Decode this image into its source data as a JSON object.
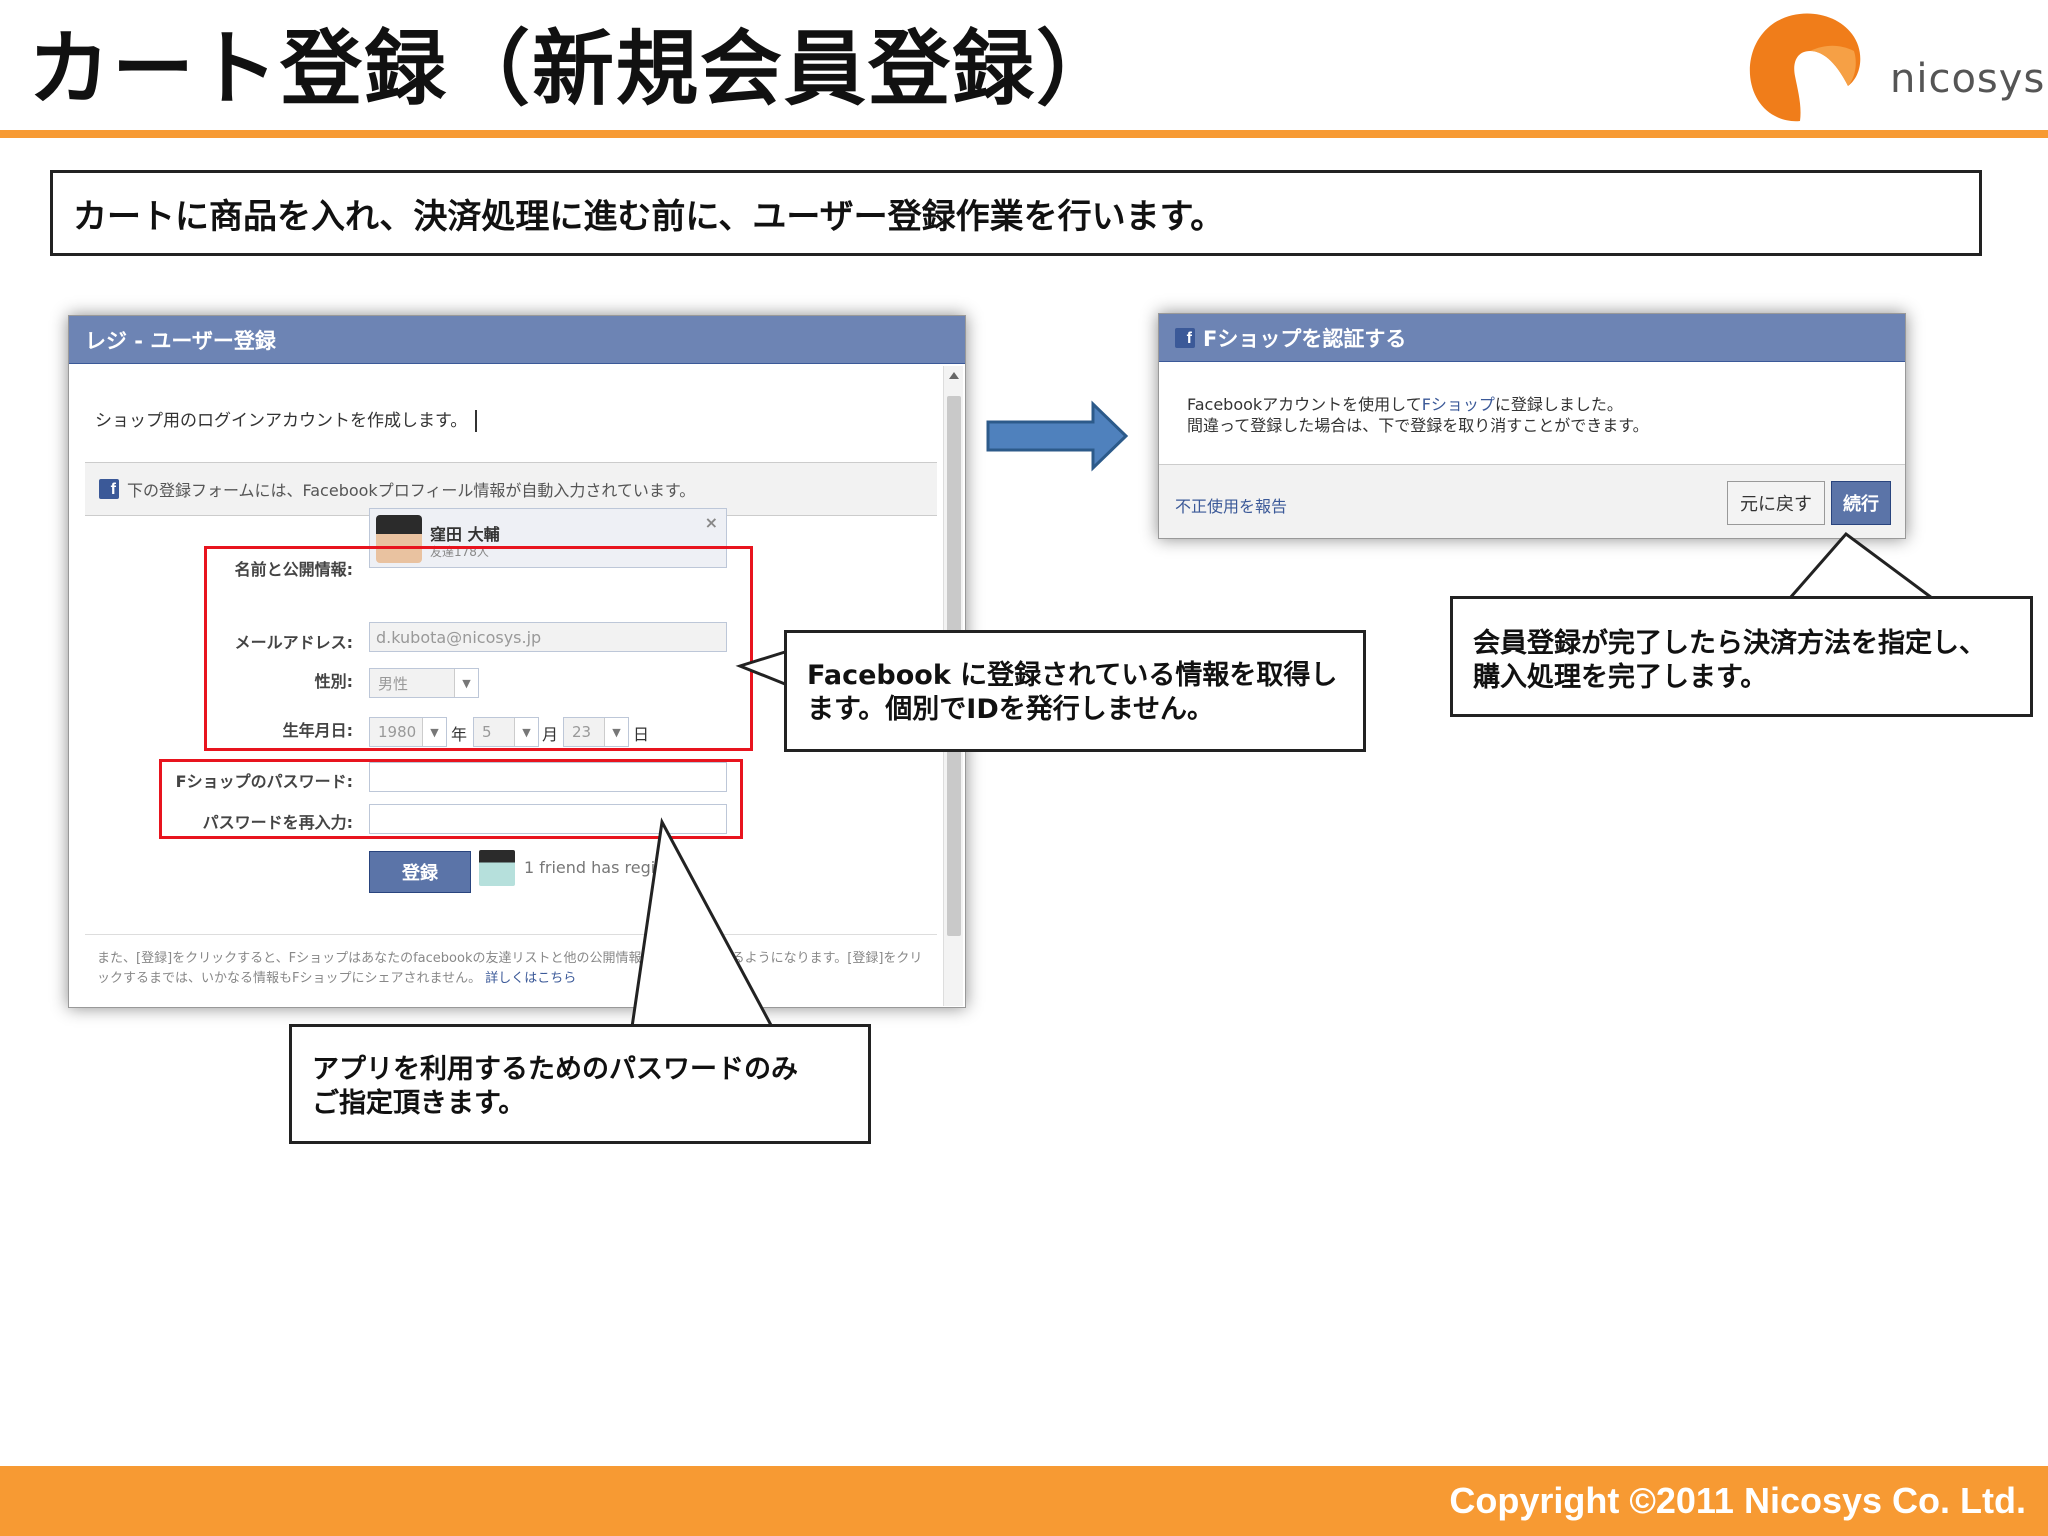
{
  "slide": {
    "title": "カート登録（新規会員登録）",
    "logo_text": "nicosys",
    "intro": "カートに商品を入れ、決済処理に進む前に、ユーザー登録作業を行います。",
    "copyright": "Copyright ©2011 Nicosys Co. Ltd."
  },
  "register_dialog": {
    "title": "レジ - ユーザー登録",
    "intro": "ショップ用のログインアカウントを作成します。",
    "notice": "下の登録フォームには、Facebookプロフィール情報が自動入力されています。",
    "fb_badge": "f",
    "labels": {
      "name": "名前と公開情報:",
      "email": "メールアドレス:",
      "gender": "性別:",
      "birthday": "生年月日:",
      "password": "Fショップのパスワード:",
      "password_confirm": "パスワードを再入力:"
    },
    "profile": {
      "name": "窪田 大輔",
      "friends": "友達178人",
      "remove": "×"
    },
    "email_value": "d.kubota@nicosys.jp",
    "gender_value": "男性",
    "birthday": {
      "year": "1980",
      "year_unit": "年",
      "month": "5",
      "month_unit": "月",
      "day": "23",
      "day_unit": "日"
    },
    "password_value": "",
    "password_confirm_value": "",
    "register_button": "登録",
    "friend_text": "1 friend has regis",
    "footer_text": "また、[登録]をクリックすると、Fショップはあなたのfacebookの友達リストと他の公開情報にアクセスできるようになります。[登録]をクリックするまでは、いかなる情報もFショップにシェアされません。",
    "footer_link": "詳しくはこちら"
  },
  "auth_dialog": {
    "fb_badge": "f",
    "title": "Fショップを認証する",
    "message_pre": "Facebookアカウントを使用して",
    "message_link": "Fショップ",
    "message_post": "に登録しました。",
    "message_line2": "間違って登録した場合は、下で登録を取り消すことができます。",
    "report_link": "不正使用を報告",
    "revert_button": "元に戻す",
    "continue_button": "続行"
  },
  "callouts": {
    "facebook_info_line1": "Facebook に登録されている情報を取得し",
    "facebook_info_line2": "ます。個別でIDを発行しません。",
    "password_line1": "アプリを利用するためのパスワードのみ",
    "password_line2": "ご指定頂きます。",
    "complete_line1": "会員登録が完了したら決済方法を指定し、",
    "complete_line2": "購入処理を完了します。"
  },
  "colors": {
    "accent_orange": "#f79a33",
    "facebook_blue": "#6d84b4",
    "facebook_dark": "#3b5998",
    "highlight_red": "#e8141e",
    "arrow_blue": "#4f81bd"
  }
}
